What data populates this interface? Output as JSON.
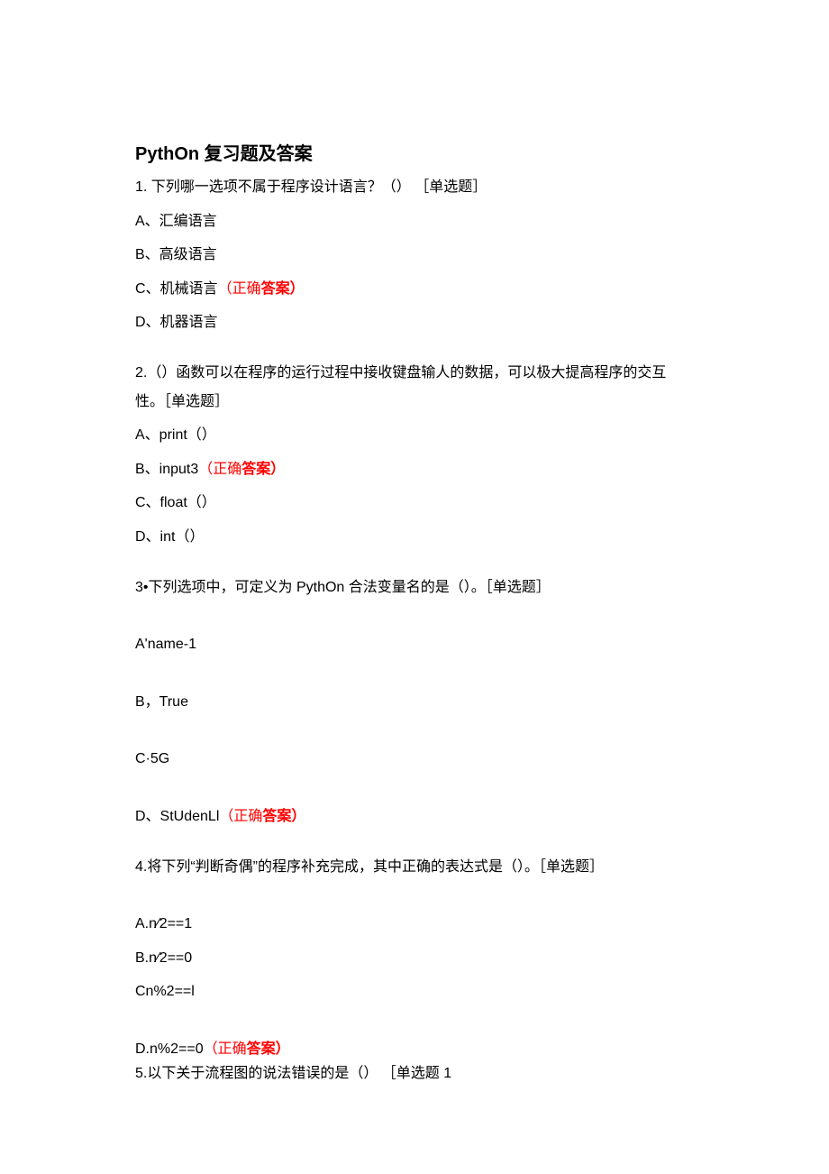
{
  "title": "PythOn 复习题及答案",
  "q1": {
    "stem": "1. 下列哪一选项不属于程序设计语言？（） ［单选题］",
    "a": "A、汇编语言",
    "b": "B、高级语言",
    "c_prefix": "C、机械语言",
    "c_ans": "（正确",
    "c_ans_bold": "答案）",
    "d": "D、机器语言"
  },
  "q2": {
    "stem1": "2.（）函数可以在程序的运行过程中接收键盘输人的数据，可以极大提高程序的交互",
    "stem2": "性。［单选题］",
    "a": "A、print（）",
    "b_prefix": "B、input3",
    "b_ans": "（正确",
    "b_ans_bold": "答案）",
    "c": "C、float（）",
    "d": "D、int（）"
  },
  "q3": {
    "stem": "3•下列选项中，可定义为 PythOn 合法变量名的是（）。［单选题］",
    "a": "A'name-1",
    "b": "B，True",
    "c": "C·5G",
    "d_prefix": "D、StUdenLl",
    "d_ans": "（正确",
    "d_ans_bold": "答案）"
  },
  "q4": {
    "stem": "4.将下列“判断奇偶”的程序补充完成，其中正确的表达式是（）。［单选题］",
    "a": "A.n⁄2==1",
    "b": "B.n⁄2==0",
    "c": "Cn%2==l",
    "d_prefix": "D.n%2==0",
    "d_ans": "（正确",
    "d_ans_bold": "答案）"
  },
  "q5": {
    "stem": "5.以下关于流程图的说法错误的是（） ［单选题 1"
  }
}
